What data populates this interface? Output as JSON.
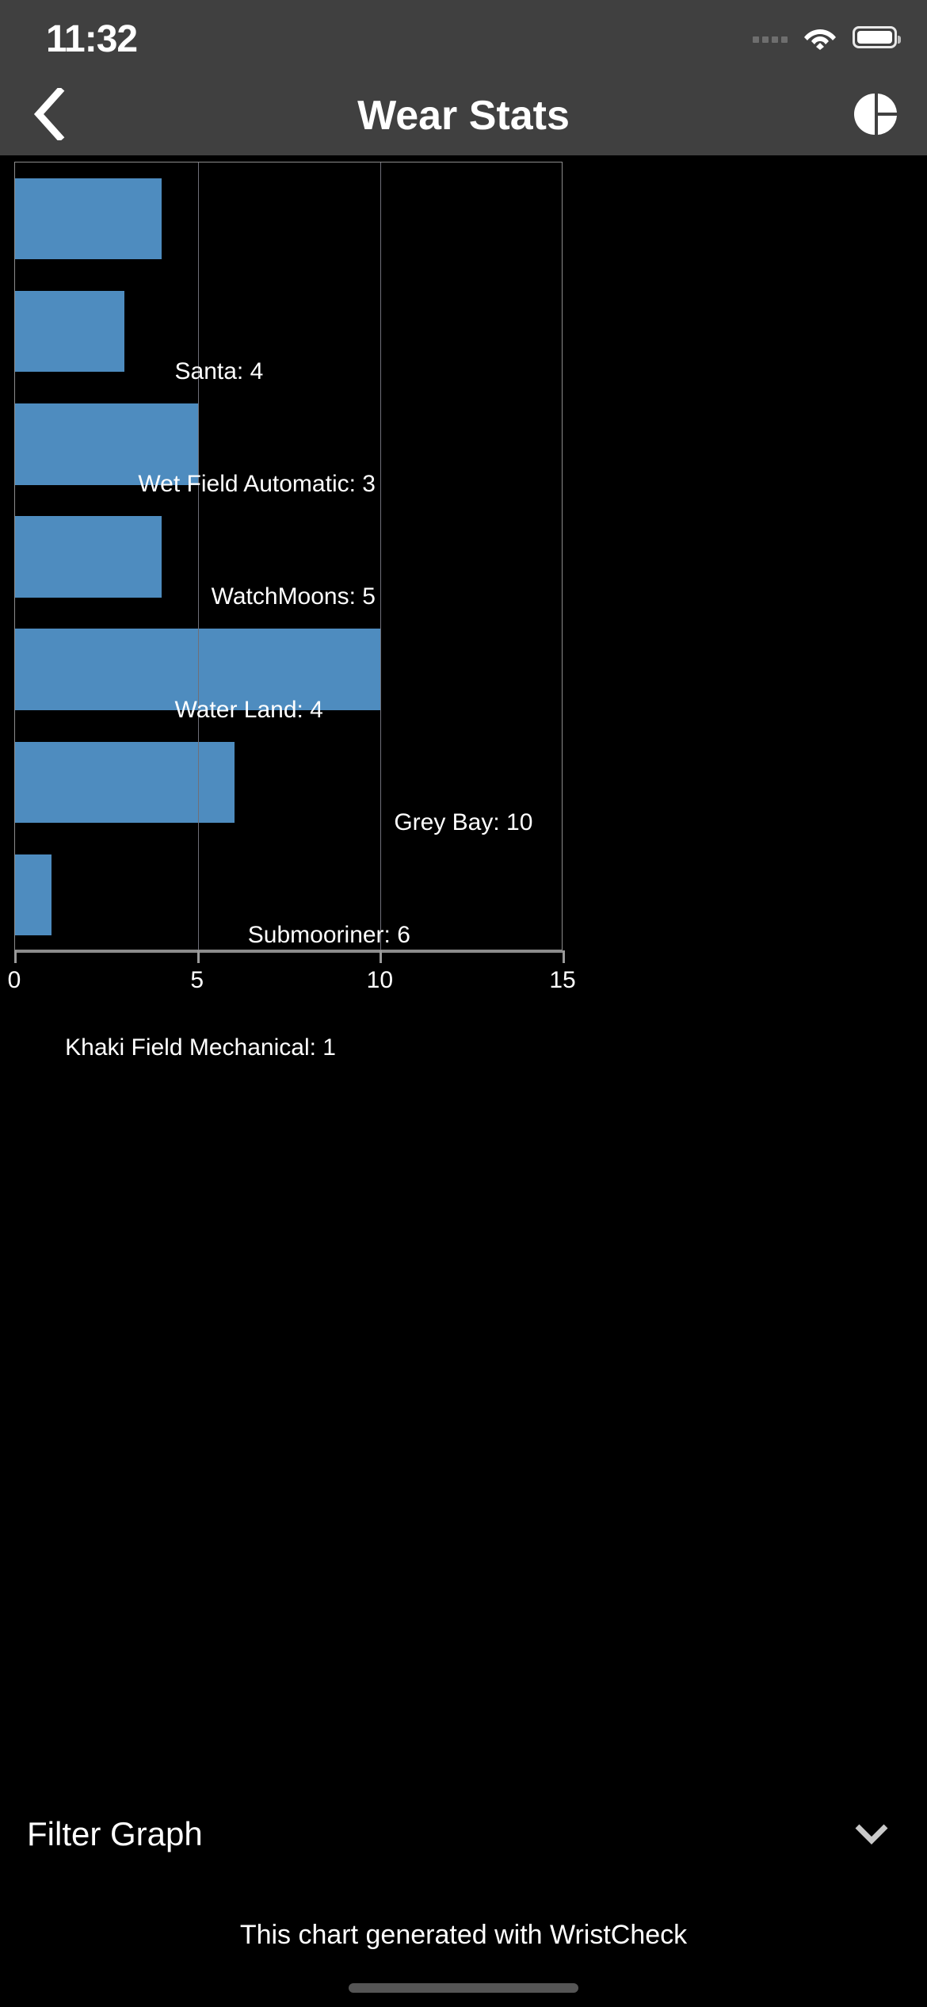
{
  "status_bar": {
    "time": "11:32",
    "signal_icon": "signal-dots-icon",
    "wifi_icon": "wifi-icon",
    "battery_icon": "battery-icon"
  },
  "nav_bar": {
    "back_icon": "chevron-left-icon",
    "title": "Wear Stats",
    "chart_icon": "pie-chart-icon"
  },
  "filter": {
    "label": "Filter Graph",
    "chevron_icon": "chevron-down-icon"
  },
  "footer": {
    "note": "This chart generated with WristCheck"
  },
  "colors": {
    "bar": "#4e8cbf",
    "background": "#000000",
    "chrome": "#404040",
    "axis": "#8c8c8c",
    "grid": "#6f6f78",
    "text": "#ffffff"
  },
  "chart_data": {
    "type": "bar",
    "orientation": "horizontal",
    "title": "",
    "xlabel": "",
    "ylabel": "",
    "xlim": [
      0,
      15
    ],
    "xticks": [
      0,
      5,
      10,
      15
    ],
    "xtick_labels": [
      "0",
      "5",
      "10",
      "15"
    ],
    "grid": true,
    "legend": false,
    "categories": [
      "Santa",
      "Wet Field Automatic",
      "WatchMoons",
      "Water Land",
      "Grey Bay",
      "Submooriner",
      "Khaki Field Mechanical"
    ],
    "values": [
      4,
      3,
      5,
      4,
      10,
      6,
      1
    ],
    "bar_labels": [
      "Santa: 4",
      "Wet Field Automatic: 3",
      "WatchMoons: 5",
      "Water Land: 4",
      "Grey Bay: 10",
      "Submooriner: 6",
      "Khaki Field Mechanical: 1"
    ]
  }
}
